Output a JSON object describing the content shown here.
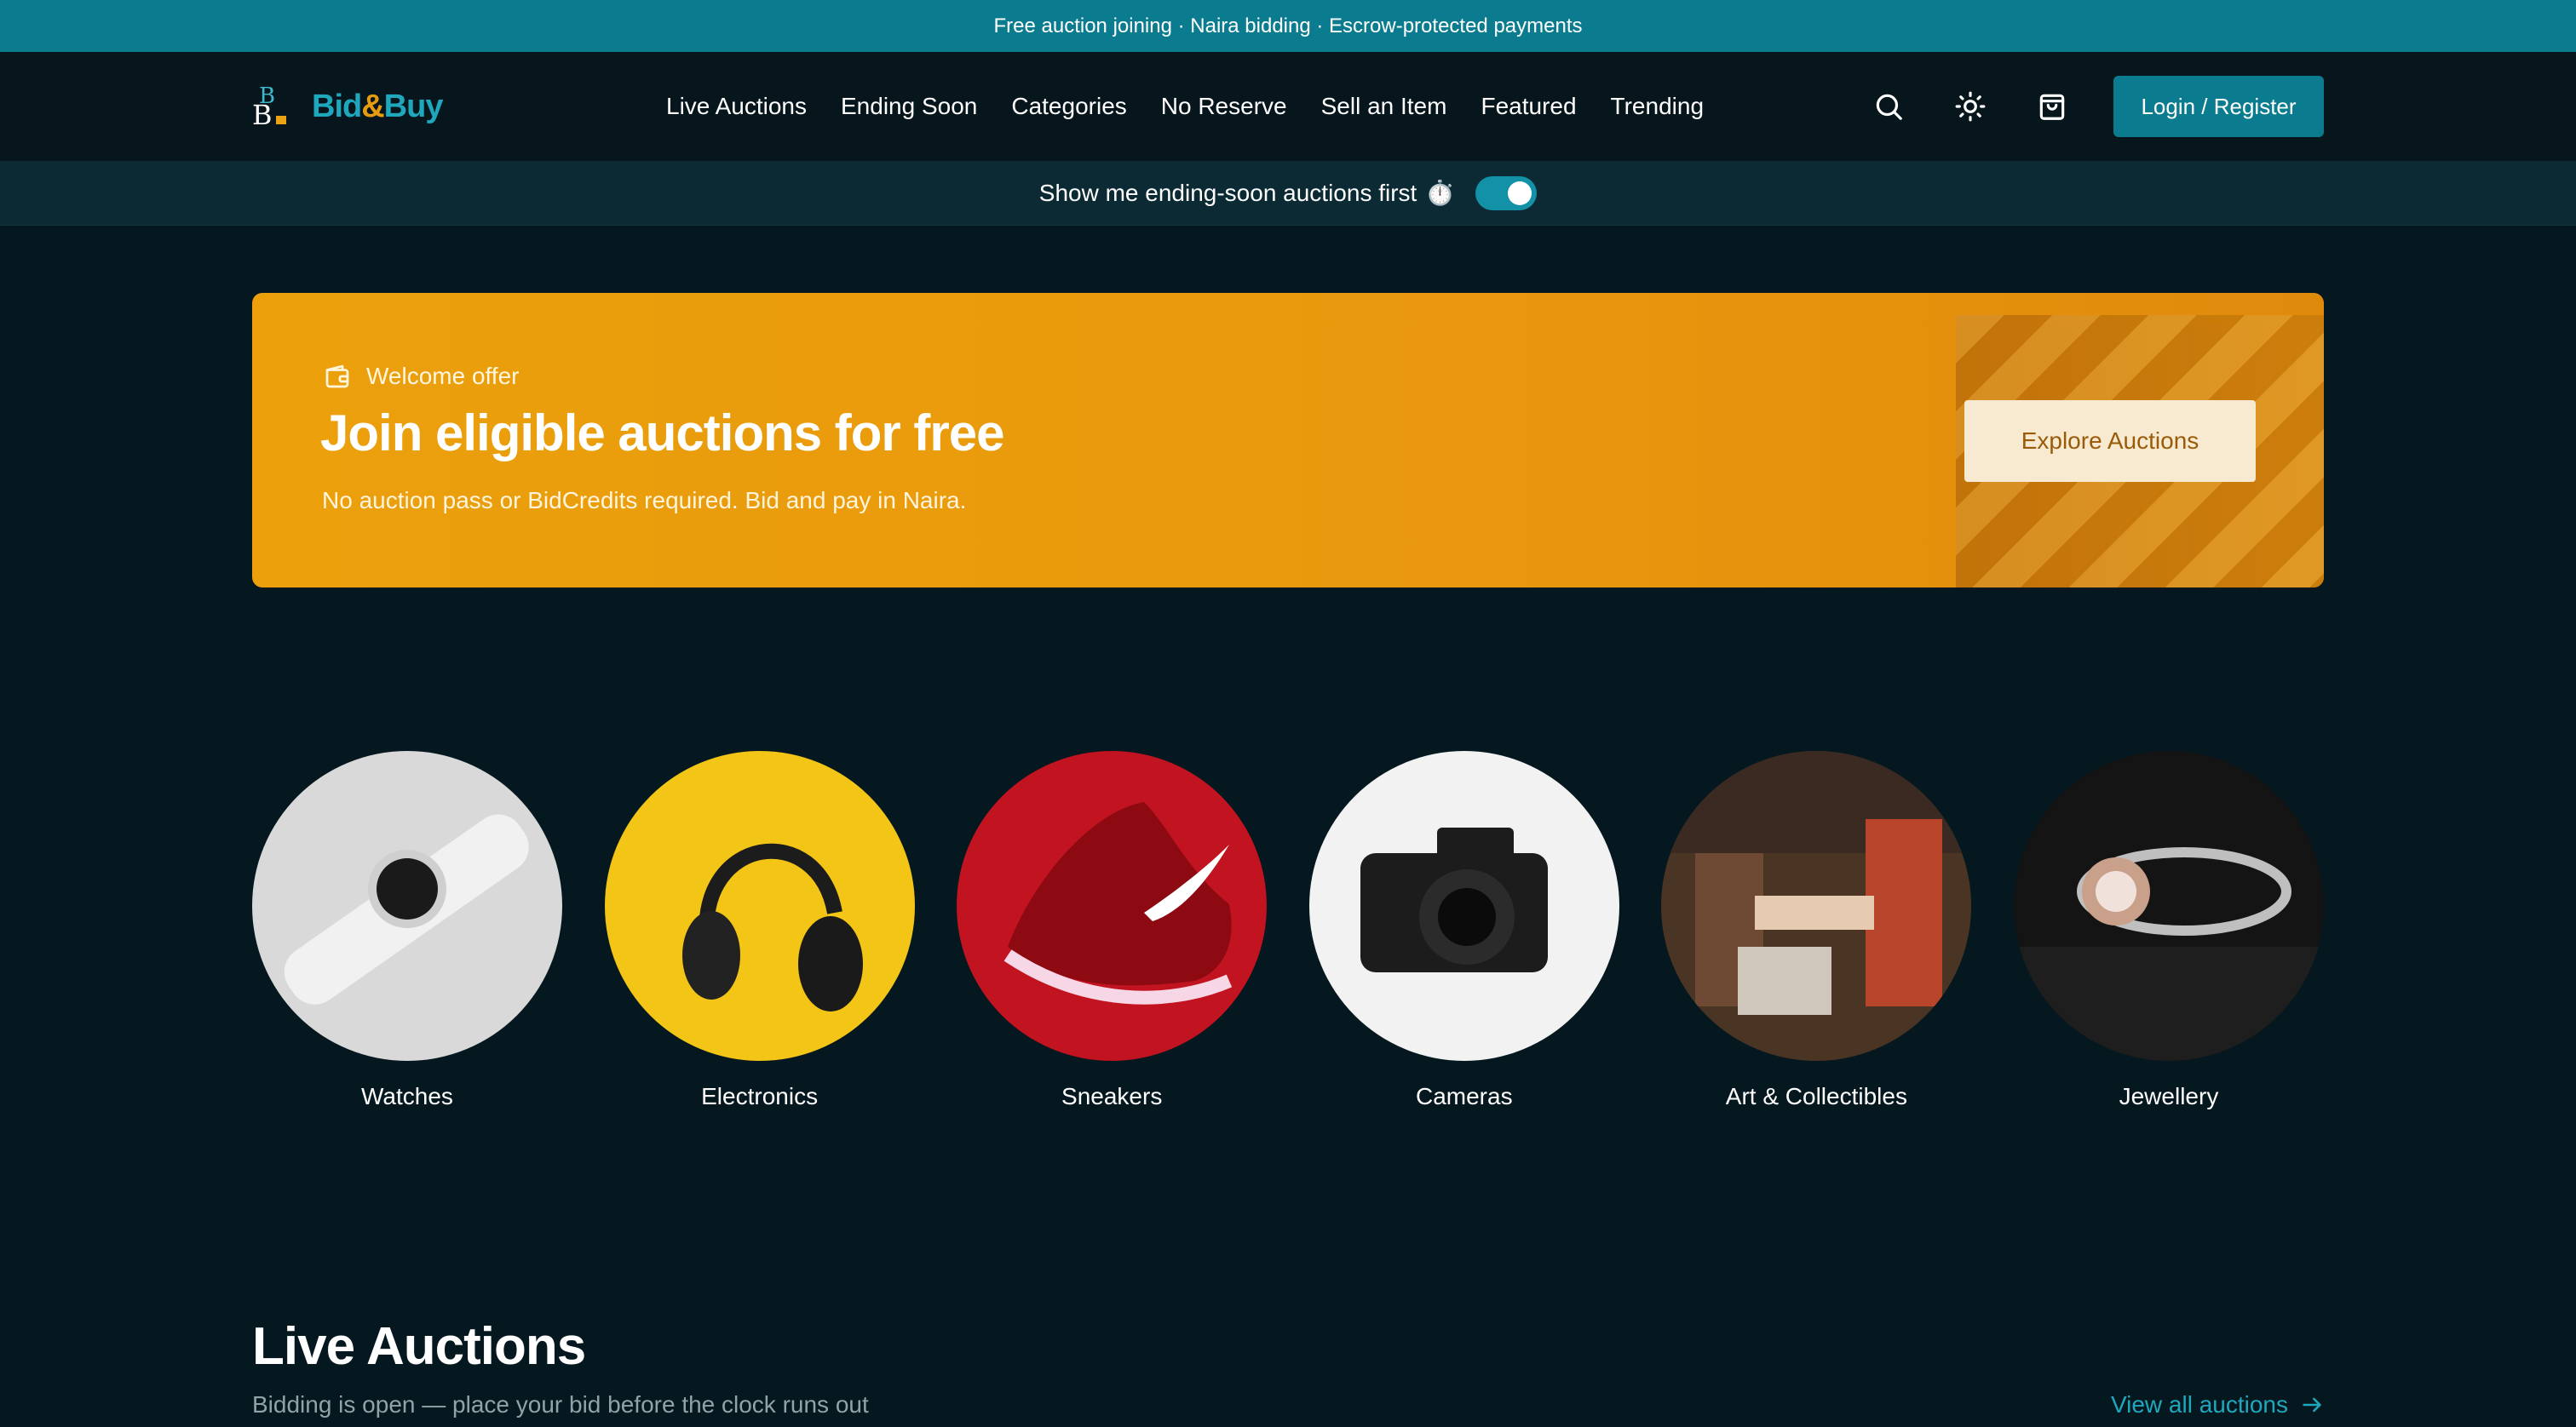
{
  "announcement": "Free auction joining · Naira bidding · Escrow-protected payments",
  "brand": {
    "bid": "Bid",
    "amp": "&",
    "buy": "Buy"
  },
  "nav": [
    "Live Auctions",
    "Ending Soon",
    "Categories",
    "No Reserve",
    "Sell an Item",
    "Featured",
    "Trending"
  ],
  "header": {
    "icons": [
      "search-icon",
      "sun-icon",
      "shopping-bag-icon"
    ],
    "login_label": "Login / Register"
  },
  "toggle": {
    "label": "Show me ending-soon auctions first",
    "emoji": "⏱️",
    "enabled": true
  },
  "promo": {
    "tag": "Welcome offer",
    "title": "Join eligible auctions for free",
    "subtitle": "No auction pass or BidCredits required. Bid and pay in Naira.",
    "button": "Explore Auctions"
  },
  "categories": [
    "Watches",
    "Electronics",
    "Sneakers",
    "Cameras",
    "Art & Collectibles",
    "Jewellery"
  ],
  "live": {
    "title": "Live Auctions",
    "subtitle": "Bidding is open — place your bid before the clock runs out",
    "view_all": "View all auctions"
  },
  "colors": {
    "accent": "#0b7c8f",
    "link": "#1fa7bd",
    "gold": "#eba00c",
    "background": "#05181f"
  }
}
